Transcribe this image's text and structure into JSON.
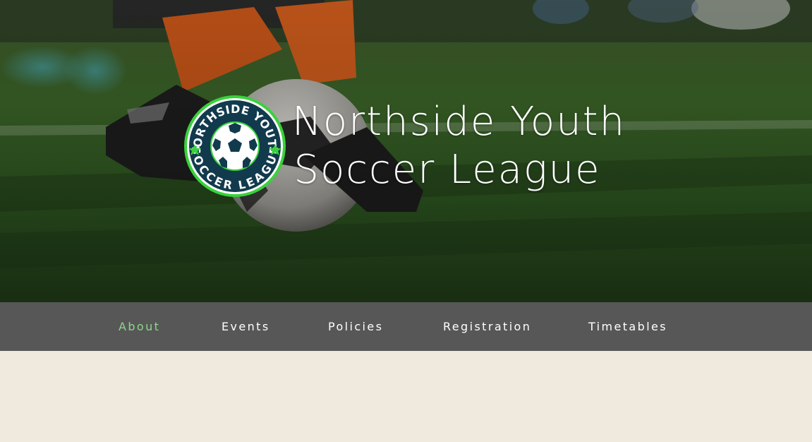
{
  "site": {
    "title_line1": "Northside Youth",
    "title_line2": "Soccer League",
    "logo": {
      "text_top": "NORTHSIDE YOUTH",
      "text_bottom": "SOCCER LEAGUE",
      "icon": "soccer-ball-icon"
    }
  },
  "nav": {
    "items": [
      {
        "label": "About",
        "active": true
      },
      {
        "label": "Events",
        "active": false
      },
      {
        "label": "Policies",
        "active": false
      },
      {
        "label": "Registration",
        "active": false
      },
      {
        "label": "Timetables",
        "active": false
      }
    ]
  },
  "colors": {
    "nav_bg": "#575757",
    "nav_active": "#8ed68a",
    "page_bg": "#f0e9dd",
    "logo_green": "#39d13c",
    "logo_navy": "#123a4d"
  }
}
